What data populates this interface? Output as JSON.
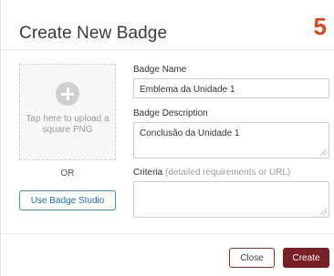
{
  "dialog": {
    "title": "Create New Badge",
    "step_number": "5"
  },
  "upload": {
    "text": "Tap here to upload a square PNG",
    "icon": "plus-circle-icon"
  },
  "or_label": "OR",
  "studio_button": "Use Badge Studio",
  "form": {
    "name_label": "Badge Name",
    "name_value": "Emblema da Unidade 1",
    "description_label": "Badge Description",
    "description_value": "Conclusão da Unidade 1",
    "criteria_label": "Criteria",
    "criteria_hint": "(detailed requirements or URL)",
    "criteria_value": ""
  },
  "footer": {
    "close_label": "Close",
    "create_label": "Create"
  },
  "colors": {
    "step_badge": "#e0451f",
    "primary_button": "#7a1f25",
    "studio_button_border": "#3d8fd0"
  }
}
